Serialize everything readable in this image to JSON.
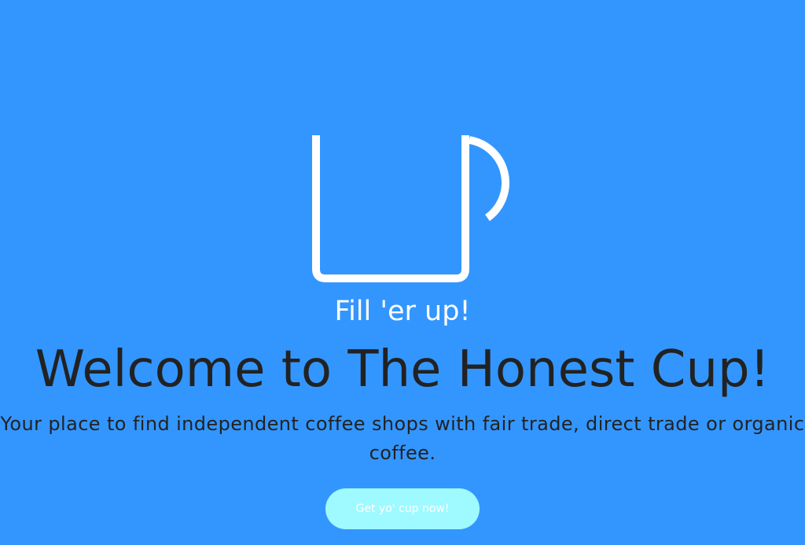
{
  "hero": {
    "icon": "coffee-mug-icon",
    "tagline": "Fill 'er up!",
    "title": "Welcome to The Honest Cup!",
    "subtitle": "Your place to find independent coffee shops with fair trade, direct trade or organic coffee.",
    "cta_label": "Get yo' cup now!"
  },
  "colors": {
    "background": "#3396ff",
    "text_dark": "#222222",
    "text_light": "#ffffff",
    "cta_background": "#9ffaff"
  }
}
